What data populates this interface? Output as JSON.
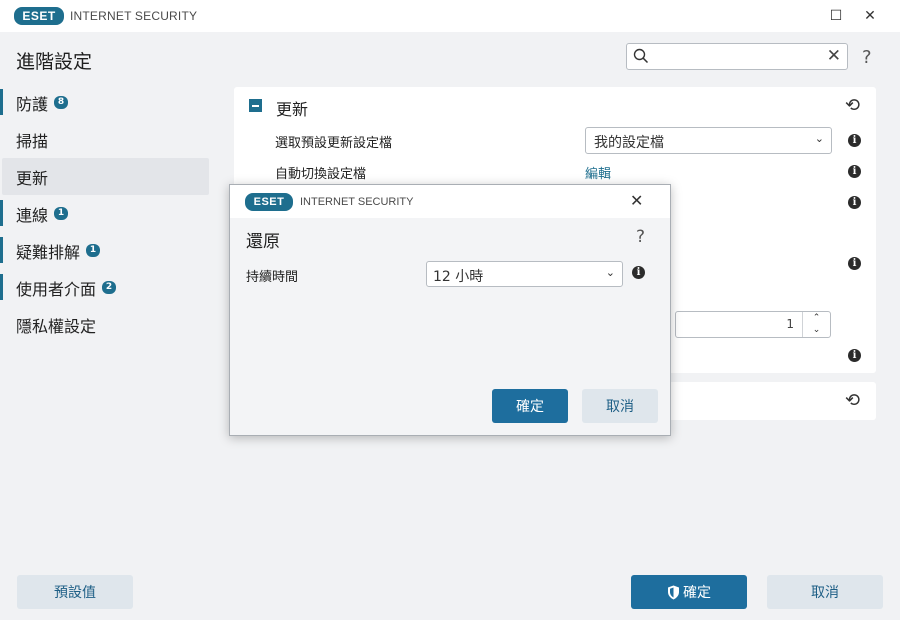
{
  "app": {
    "logo_text": "ESET",
    "product_name": "INTERNET SECURITY"
  },
  "window_controls": {
    "maximize_glyph": "☐",
    "close_glyph": "✕"
  },
  "page": {
    "title": "進階設定",
    "help_glyph": "?"
  },
  "search": {
    "value": "",
    "placeholder": "",
    "clear_glyph": "✕"
  },
  "sidebar": {
    "items": [
      {
        "label": "防護",
        "badge": "8"
      },
      {
        "label": "掃描",
        "badge": ""
      },
      {
        "label": "更新",
        "badge": ""
      },
      {
        "label": "連線",
        "badge": "1"
      },
      {
        "label": "疑難排解",
        "badge": "1"
      },
      {
        "label": "使用者介面",
        "badge": "2"
      },
      {
        "label": "隱私權設定",
        "badge": ""
      }
    ]
  },
  "section": {
    "title": "更新",
    "rows": [
      {
        "label": "選取預設更新設定檔",
        "control": "select",
        "value": "我的設定檔"
      },
      {
        "label": "自動切換設定檔",
        "control": "link",
        "value": "編輯"
      }
    ],
    "spinner_value": "1",
    "undo_glyph": "⟲",
    "info_glyph": "i"
  },
  "dialog": {
    "logo_text": "ESET",
    "product_name": "INTERNET SECURITY",
    "close_glyph": "✕",
    "heading": "還原",
    "help_glyph": "?",
    "duration_label": "持續時間",
    "duration_value": "12 小時",
    "ok_label": "確定",
    "cancel_label": "取消"
  },
  "footer": {
    "defaults_label": "預設值",
    "ok_label": "確定",
    "cancel_label": "取消"
  },
  "colors": {
    "accent": "#1e6e8e",
    "primary_button": "#1e6e9e",
    "secondary_button": "#dfe6ec",
    "background": "#f1f2f4"
  }
}
